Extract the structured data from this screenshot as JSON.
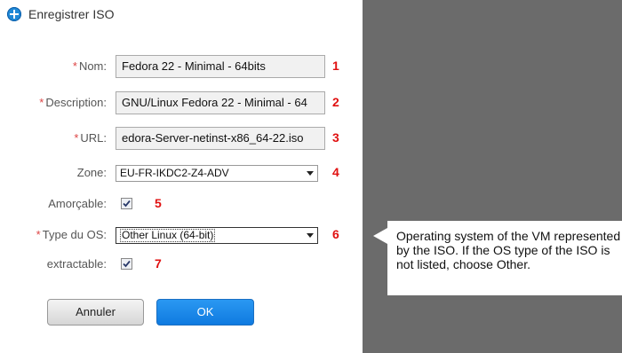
{
  "dialog": {
    "title": "Enregistrer ISO",
    "icon": "plus-circle-icon"
  },
  "form": {
    "required_marker": "*",
    "name": {
      "label": "Nom:",
      "value": "Fedora 22 - Minimal - 64bits",
      "number": "1"
    },
    "description": {
      "label": "Description:",
      "value": "GNU/Linux Fedora 22 - Minimal - 64",
      "number": "2"
    },
    "url": {
      "label": "URL:",
      "value": "edora-Server-netinst-x86_64-22.iso",
      "number": "3"
    },
    "zone": {
      "label": "Zone:",
      "value": "EU-FR-IKDC2-Z4-ADV",
      "number": "4"
    },
    "bootable": {
      "label": "Amorçable:",
      "checked": true,
      "number": "5"
    },
    "os_type": {
      "label": "Type du OS:",
      "value": "Other Linux (64-bit)",
      "number": "6"
    },
    "extractable": {
      "label": "extractable:",
      "checked": true,
      "number": "7"
    }
  },
  "buttons": {
    "cancel": "Annuler",
    "ok": "OK"
  },
  "tooltip": {
    "text": "Operating system of the VM represented by the ISO. If the OS type of the ISO is not listed, choose Other."
  },
  "colors": {
    "annotation": "#e01010",
    "primary_button": "#1e88e5",
    "required_marker": "#d44444",
    "backdrop": "#6b6b6b"
  }
}
